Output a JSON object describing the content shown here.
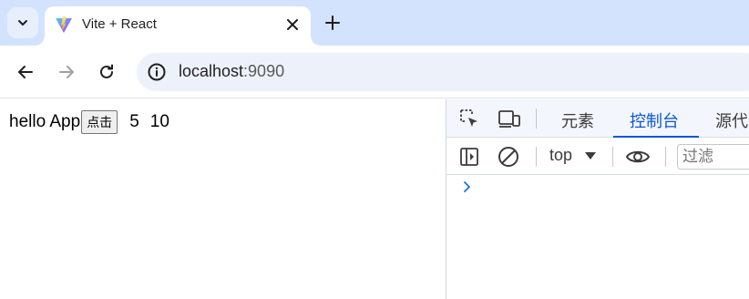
{
  "browser": {
    "tab": {
      "title": "Vite + React",
      "favicon": "vite-logo-icon"
    },
    "address": {
      "host": "localhost",
      "port": ":9090"
    },
    "icons": {
      "tab_search": "chevron-down-icon",
      "close": "close-icon",
      "new_tab": "plus-icon",
      "back": "arrow-left-icon",
      "forward": "arrow-right-icon",
      "reload": "reload-icon",
      "site_info": "info-icon"
    },
    "colors": {
      "tabstrip_bg": "#d3e3fd",
      "omnibox_bg": "#edf2fa",
      "accent": "#0b57d0"
    }
  },
  "page": {
    "greeting": "hello App",
    "button_label": "点击",
    "value_a": "5",
    "value_b": "10"
  },
  "devtools": {
    "tabs": [
      {
        "label": "元素",
        "active": false
      },
      {
        "label": "控制台",
        "active": true
      },
      {
        "label": "源代",
        "active": false
      }
    ],
    "console": {
      "context": "top",
      "filter_placeholder": "过滤"
    }
  }
}
